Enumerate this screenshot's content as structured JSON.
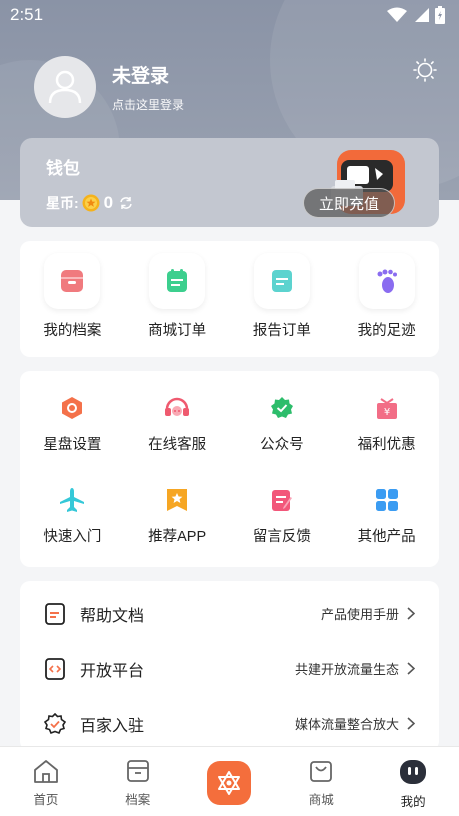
{
  "status_bar": {
    "time": "2:51"
  },
  "profile": {
    "name": "未登录",
    "subtitle": "点击这里登录"
  },
  "wallet": {
    "title": "钱包",
    "coins_label": "星币:",
    "coins_value": "0",
    "recharge_label": "立即充值"
  },
  "orders": [
    {
      "label": "我的档案",
      "icon": "archive-icon",
      "color": "#f07a7e"
    },
    {
      "label": "商城订单",
      "icon": "mall-order-icon",
      "color": "#3ccf8e"
    },
    {
      "label": "报告订单",
      "icon": "report-order-icon",
      "color": "#5cd3cf"
    },
    {
      "label": "我的足迹",
      "icon": "footprint-icon",
      "color": "#8a6cf0"
    }
  ],
  "services": [
    {
      "label": "星盘设置",
      "icon": "star-chart-settings-icon",
      "color": "#f4714a"
    },
    {
      "label": "在线客服",
      "icon": "headset-icon",
      "color": "#ef5a6f"
    },
    {
      "label": "公众号",
      "icon": "official-account-icon",
      "color": "#2dbd6b"
    },
    {
      "label": "福利优惠",
      "icon": "gift-icon",
      "color": "#f26d86"
    },
    {
      "label": "快速入门",
      "icon": "airplane-icon",
      "color": "#35c8d8"
    },
    {
      "label": "推荐APP",
      "icon": "recommend-app-icon",
      "color": "#f6a623"
    },
    {
      "label": "留言反馈",
      "icon": "feedback-icon",
      "color": "#f2577a"
    },
    {
      "label": "其他产品",
      "icon": "other-products-icon",
      "color": "#3b9cf2"
    }
  ],
  "links": [
    {
      "title": "帮助文档",
      "subtitle": "产品使用手册",
      "icon": "help-doc-icon"
    },
    {
      "title": "开放平台",
      "subtitle": "共建开放流量生态",
      "icon": "open-platform-icon"
    },
    {
      "title": "百家入驻",
      "subtitle": "媒体流量整合放大",
      "icon": "settle-in-icon"
    }
  ],
  "tabs": [
    {
      "label": "首页",
      "icon": "home-icon"
    },
    {
      "label": "档案",
      "icon": "archive-tab-icon"
    },
    {
      "label": "",
      "icon": "star-center-icon"
    },
    {
      "label": "商城",
      "icon": "mall-icon"
    },
    {
      "label": "我的",
      "icon": "profile-tab-icon",
      "active": true
    }
  ],
  "colors": {
    "accent": "#f46e3c",
    "header": "#8a93a6"
  }
}
